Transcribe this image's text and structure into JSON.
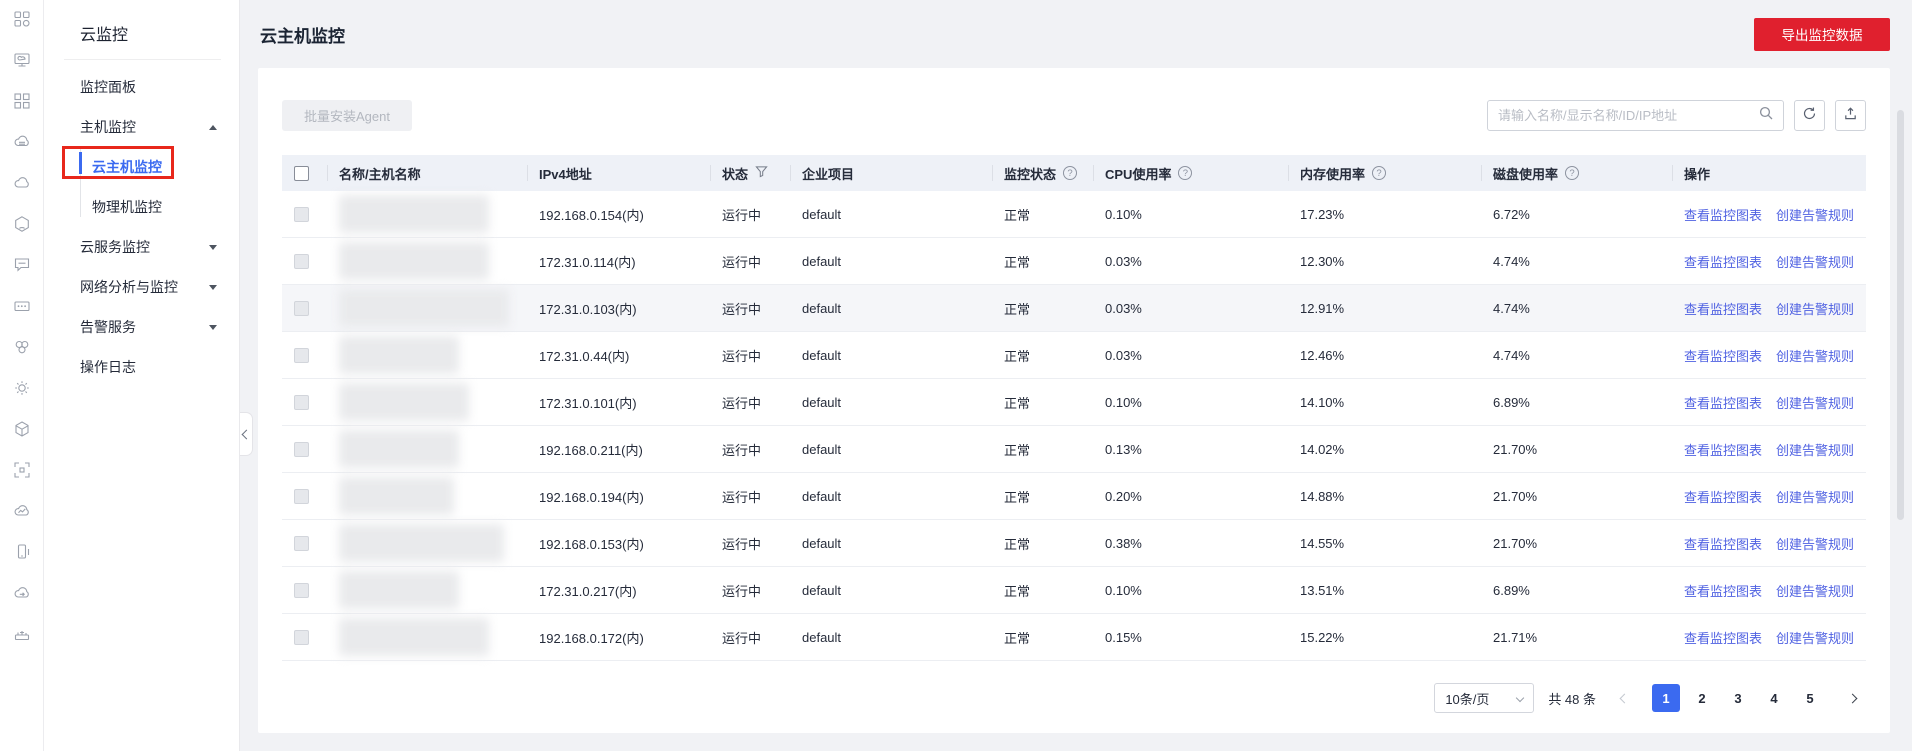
{
  "colors": {
    "brand_red": "#e0202e",
    "accent_blue": "#3b6af0",
    "link_blue": "#5062e2",
    "table_header_bg": "#eef1f7",
    "row_highlight": "#f5f6f9"
  },
  "icon_rail": {
    "icons": [
      "apps-icon",
      "monitor-icon",
      "grid-icon",
      "cloud-server-icon",
      "cloud-icon",
      "hexagon-icon",
      "chat-icon",
      "card-icon",
      "cluster-icon",
      "gear-icon",
      "cube-icon",
      "frame-icon",
      "cloud-chart-icon",
      "phone-icon",
      "cloud-sync-icon",
      "dock-icon"
    ]
  },
  "sidebar": {
    "title": "云监控",
    "items": [
      {
        "key": "dashboard",
        "label": "监控面板",
        "type": "item"
      },
      {
        "key": "host-monitoring",
        "label": "主机监控",
        "type": "group",
        "expanded": true
      },
      {
        "key": "cloud-host-monitoring",
        "label": "云主机监控",
        "type": "sub",
        "selected": true
      },
      {
        "key": "physical-host-monitoring",
        "label": "物理机监控",
        "type": "sub"
      },
      {
        "key": "cloud-service-monitoring",
        "label": "云服务监控",
        "type": "group",
        "expanded": false
      },
      {
        "key": "network-analysis",
        "label": "网络分析与监控",
        "type": "group",
        "expanded": false
      },
      {
        "key": "alarm-service",
        "label": "告警服务",
        "type": "group",
        "expanded": false
      },
      {
        "key": "operation-log",
        "label": "操作日志",
        "type": "item"
      }
    ]
  },
  "header": {
    "title": "云主机监控",
    "export_button": "导出监控数据"
  },
  "toolbar": {
    "batch_agent_button": "批量安装Agent",
    "search_placeholder": "请输入名称/显示名称/ID/IP地址"
  },
  "table": {
    "columns": [
      {
        "key": "checkbox",
        "label": ""
      },
      {
        "key": "name",
        "label": "名称/主机名称"
      },
      {
        "key": "ip",
        "label": "IPv4地址"
      },
      {
        "key": "status",
        "label": "状态",
        "icon": "filter"
      },
      {
        "key": "project",
        "label": "企业项目"
      },
      {
        "key": "monitor_status",
        "label": "监控状态",
        "icon": "help"
      },
      {
        "key": "cpu",
        "label": "CPU使用率",
        "icon": "help"
      },
      {
        "key": "memory",
        "label": "内存使用率",
        "icon": "help"
      },
      {
        "key": "disk",
        "label": "磁盘使用率",
        "icon": "help"
      },
      {
        "key": "actions",
        "label": "操作"
      }
    ],
    "actions": {
      "view": "查看监控图表",
      "create": "创建告警规则"
    },
    "rows": [
      {
        "name_redacted": true,
        "ip": "192.168.0.154(内)",
        "status": "运行中",
        "project": "default",
        "monitor": "正常",
        "cpu": "0.10%",
        "memory": "17.23%",
        "disk": "6.72%"
      },
      {
        "name_redacted": true,
        "ip": "172.31.0.114(内)",
        "status": "运行中",
        "project": "default",
        "monitor": "正常",
        "cpu": "0.03%",
        "memory": "12.30%",
        "disk": "4.74%"
      },
      {
        "name_redacted": true,
        "ip": "172.31.0.103(内)",
        "status": "运行中",
        "project": "default",
        "monitor": "正常",
        "cpu": "0.03%",
        "memory": "12.91%",
        "disk": "4.74%",
        "highlighted": true
      },
      {
        "name_redacted": true,
        "ip": "172.31.0.44(内)",
        "status": "运行中",
        "project": "default",
        "monitor": "正常",
        "cpu": "0.03%",
        "memory": "12.46%",
        "disk": "4.74%"
      },
      {
        "name_redacted": true,
        "ip": "172.31.0.101(内)",
        "status": "运行中",
        "project": "default",
        "monitor": "正常",
        "cpu": "0.10%",
        "memory": "14.10%",
        "disk": "6.89%"
      },
      {
        "name_redacted": true,
        "ip": "192.168.0.211(内)",
        "status": "运行中",
        "project": "default",
        "monitor": "正常",
        "cpu": "0.13%",
        "memory": "14.02%",
        "disk": "21.70%"
      },
      {
        "name_redacted": true,
        "ip": "192.168.0.194(内)",
        "status": "运行中",
        "project": "default",
        "monitor": "正常",
        "cpu": "0.20%",
        "memory": "14.88%",
        "disk": "21.70%"
      },
      {
        "name_redacted": true,
        "ip": "192.168.0.153(内)",
        "status": "运行中",
        "project": "default",
        "monitor": "正常",
        "cpu": "0.38%",
        "memory": "14.55%",
        "disk": "21.70%"
      },
      {
        "name_redacted": true,
        "ip": "172.31.0.217(内)",
        "status": "运行中",
        "project": "default",
        "monitor": "正常",
        "cpu": "0.10%",
        "memory": "13.51%",
        "disk": "6.89%"
      },
      {
        "name_redacted": true,
        "ip": "192.168.0.172(内)",
        "status": "运行中",
        "project": "default",
        "monitor": "正常",
        "cpu": "0.15%",
        "memory": "15.22%",
        "disk": "21.71%"
      }
    ]
  },
  "pagination": {
    "page_size_label": "10条/页",
    "total_label": "共 48 条",
    "pages": [
      "1",
      "2",
      "3",
      "4",
      "5"
    ],
    "active_page": "1"
  }
}
